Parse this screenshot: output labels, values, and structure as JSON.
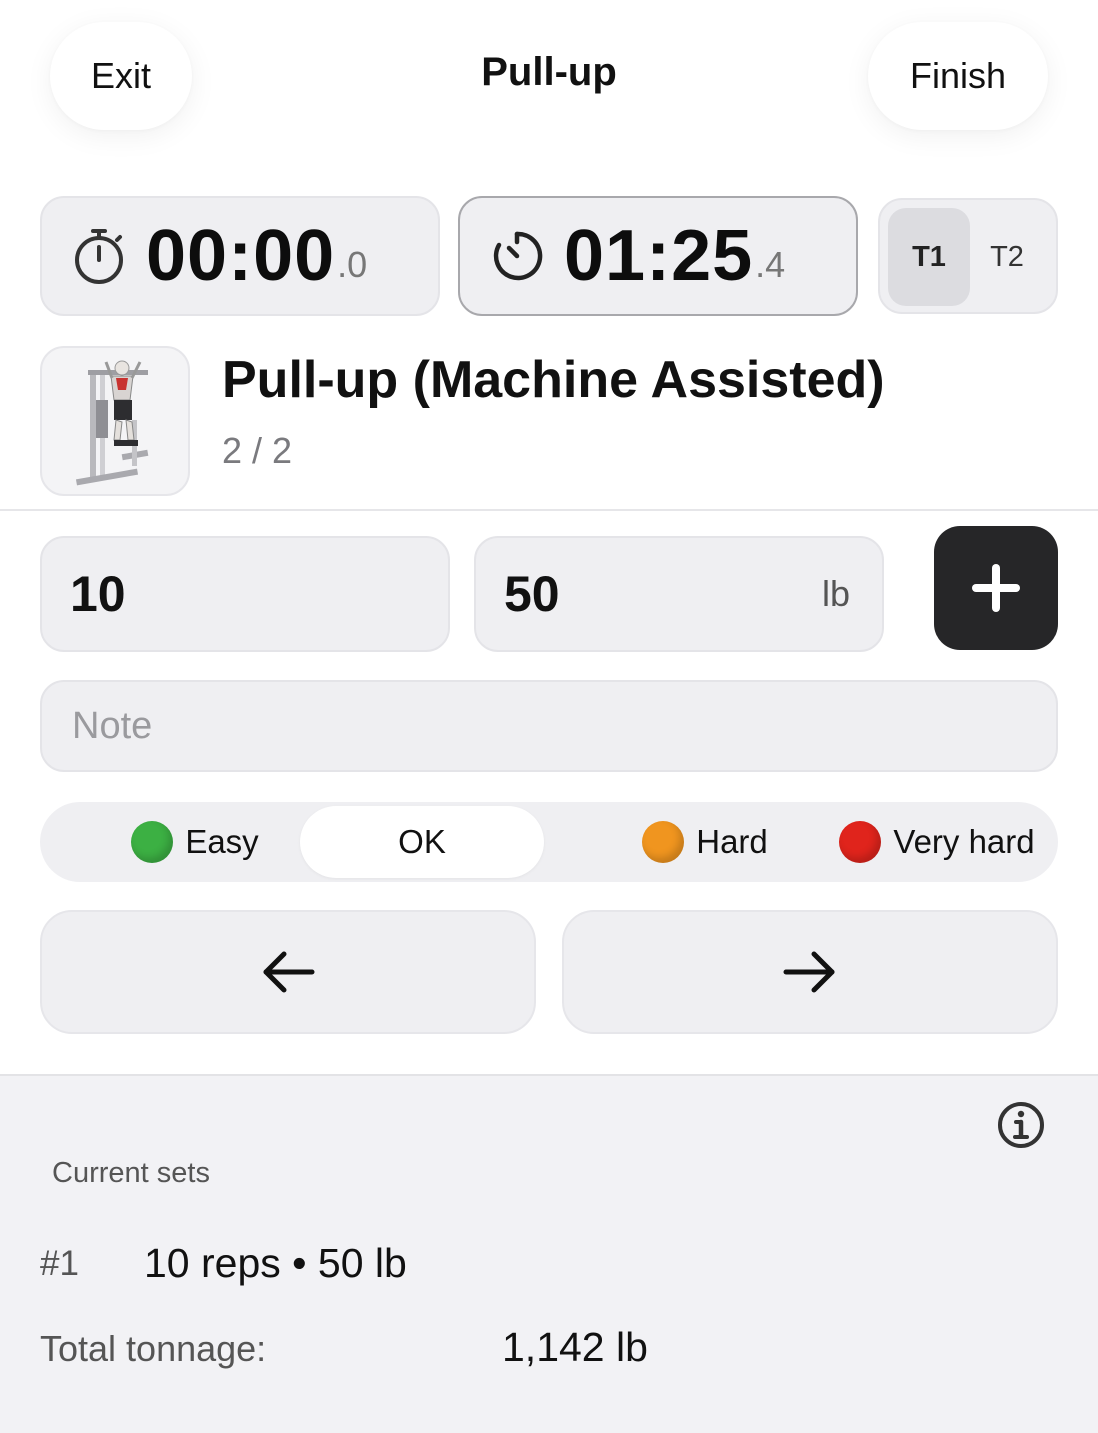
{
  "header": {
    "exit_label": "Exit",
    "title": "Pull-up",
    "finish_label": "Finish"
  },
  "timers": {
    "elapsed": {
      "main": "00:00",
      "fraction": ".0",
      "icon": "stopwatch-icon"
    },
    "rest": {
      "main": "01:25",
      "fraction": ".4",
      "icon": "countdown-timer-icon"
    },
    "tabs": [
      {
        "label": "T1",
        "selected": true
      },
      {
        "label": "T2",
        "selected": false
      }
    ]
  },
  "exercise": {
    "name": "Pull-up (Machine Assisted)",
    "set_progress": "2 / 2",
    "image_icon": "assisted-pullup-machine-icon"
  },
  "inputs": {
    "reps": "10",
    "weight": "50",
    "weight_unit": "lb",
    "add_icon": "plus-icon",
    "note_placeholder": "Note"
  },
  "difficulty": {
    "options": [
      {
        "label": "Easy",
        "color": "#3cb043"
      },
      {
        "label": "OK"
      },
      {
        "label": "Hard",
        "color": "#f0951f"
      },
      {
        "label": "Very hard",
        "color": "#e0241c"
      }
    ],
    "selected": "OK"
  },
  "navigation": {
    "prev_icon": "arrow-left-icon",
    "next_icon": "arrow-right-icon"
  },
  "summary": {
    "info_icon": "info-icon",
    "heading": "Current sets",
    "sets": [
      {
        "index": "#1",
        "detail": "10 reps • 50 lb"
      }
    ],
    "tonnage_label": "Total tonnage:",
    "tonnage_value": "1,142 lb"
  }
}
